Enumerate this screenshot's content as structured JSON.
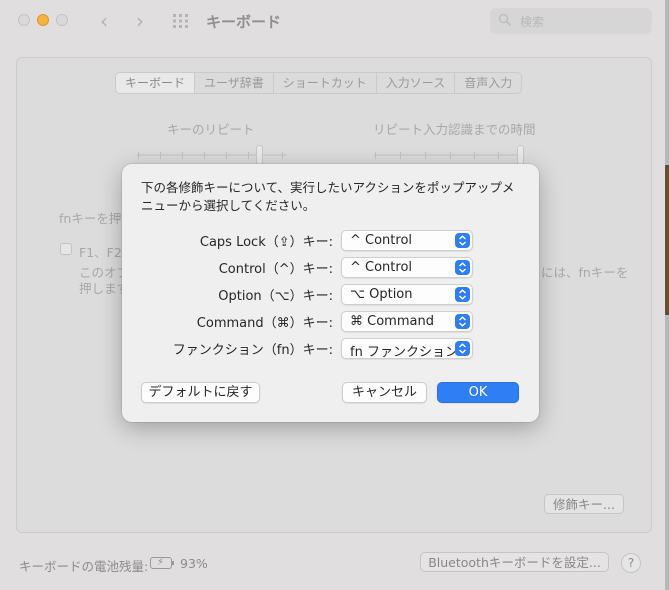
{
  "window": {
    "title": "キーボード",
    "search_placeholder": "検索"
  },
  "tabs": [
    {
      "label": "キーボード",
      "active": true
    },
    {
      "label": "ユーザ辞書",
      "active": false
    },
    {
      "label": "ショートカット",
      "active": false
    },
    {
      "label": "入力ソース",
      "active": false
    },
    {
      "label": "音声入力",
      "active": false
    }
  ],
  "background": {
    "key_repeat_label": "キーのリピート",
    "repeat_delay_label": "リピート入力認識までの時間",
    "fn_label_partial": "fnキーを押",
    "f_keys_label_partial": "F1、F2",
    "option_desc_partial_line1": "このオプ",
    "option_desc_partial_line2": "押します",
    "option_desc_right_partial": "には、fnキーを",
    "modifier_keys_button": "修飾キー...",
    "battery_label": "キーボードの電池残量:",
    "battery_percent": "93%",
    "bluetooth_button": "Bluetoothキーボードを設定...",
    "help_label": "?"
  },
  "dialog": {
    "message": "下の各修飾キーについて、実行したいアクションをポップアップメニューから選択してください。",
    "rows": [
      {
        "label": "Caps Lock（⇪）キー:",
        "value": "^ Control"
      },
      {
        "label": "Control（^）キー:",
        "value": "^ Control"
      },
      {
        "label": "Option（⌥）キー:",
        "value": "⌥ Option"
      },
      {
        "label": "Command（⌘）キー:",
        "value": "⌘ Command"
      },
      {
        "label": "ファンクション（fn）キー:",
        "value": "fn ファンクション"
      }
    ],
    "restore_defaults_button": "デフォルトに戻す",
    "cancel_button": "キャンセル",
    "ok_button": "OK",
    "accent_color": "#2f7ef3"
  }
}
